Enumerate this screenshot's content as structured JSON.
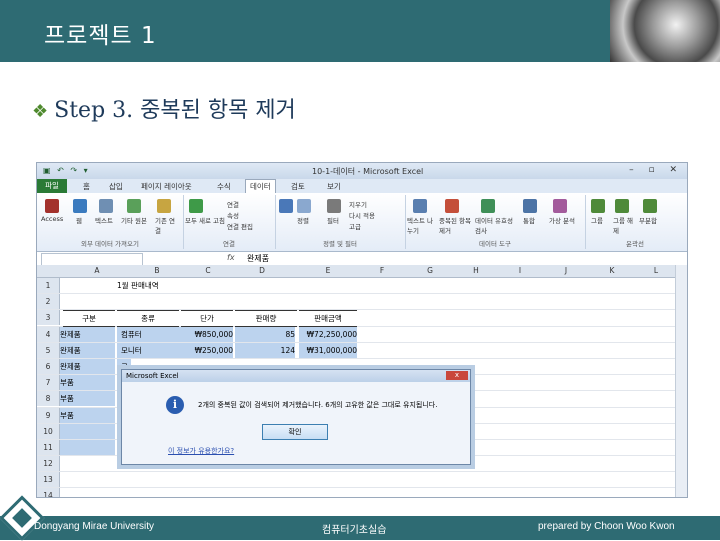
{
  "slide": {
    "title": "프로젝트 1",
    "step": "Step 3. 중복된 항목 제거",
    "bullet": "❖",
    "footer_left": "Dongyang Mirae University",
    "footer_center": "컴퓨터기초실습",
    "footer_right": "prepared by Choon Woo Kwon"
  },
  "excel": {
    "window_title": "10-1-데이터 - Microsoft Excel",
    "tabs": [
      "파일",
      "홈",
      "삽입",
      "페이지 레이아웃",
      "수식",
      "데이터",
      "검토",
      "보기"
    ],
    "active_tab": "데이터",
    "ribbon": {
      "external_items": [
        "Access",
        "웹",
        "텍스트",
        "기타 원본",
        "기존 연결"
      ],
      "external_label": "외부 데이터 가져오기",
      "refresh_item": "모두 새로 고침",
      "connect_items": [
        "연결",
        "속성",
        "연결 편집"
      ],
      "connect_label": "연결",
      "sort_item": "정렬",
      "filter_item": "필터",
      "filter_items": [
        "지우기",
        "다시 적용",
        "고급"
      ],
      "sort_label": "정렬 및 필터",
      "tools_items": [
        "텍스트 나누기",
        "중복된 항목 제거",
        "데이터 유효성 검사",
        "통합",
        "가상 분석"
      ],
      "tools_label": "데이터 도구",
      "outline_items": [
        "그룹",
        "그룹 해제",
        "부분합"
      ],
      "outline_label": "윤곽선"
    },
    "formula_value": "완제품",
    "fx": "fx",
    "columns": [
      "A",
      "B",
      "C",
      "D",
      "E",
      "F",
      "G",
      "H",
      "I",
      "J",
      "K",
      "L"
    ],
    "row_numbers": [
      "1",
      "2",
      "3",
      "4",
      "5",
      "6",
      "7",
      "8",
      "9",
      "10",
      "11",
      "12",
      "13",
      "14"
    ],
    "sheet_title": "1월 판매내역",
    "headers": [
      "구분",
      "종류",
      "단가",
      "판매량",
      "판매금액"
    ],
    "rows": [
      [
        "완제품",
        "컴퓨터",
        "₩850,000",
        "85",
        "₩72,250,000"
      ],
      [
        "완제품",
        "모니터",
        "₩250,000",
        "124",
        "₩31,000,000"
      ],
      [
        "완제품",
        "코",
        "",
        "",
        ""
      ],
      [
        "부품",
        "그",
        "",
        "",
        ""
      ],
      [
        "부품",
        "하",
        "",
        "",
        ""
      ],
      [
        "부품",
        "C",
        "",
        "",
        ""
      ]
    ],
    "dialog": {
      "title": "Microsoft Excel",
      "close": "x",
      "icon": "i",
      "message": "2개의 중복된 값이 검색되어 제거했습니다. 6개의 고유한 값은 그대로 유지됩니다.",
      "ok": "확인",
      "link": "이 정보가 유용한가요?"
    }
  }
}
